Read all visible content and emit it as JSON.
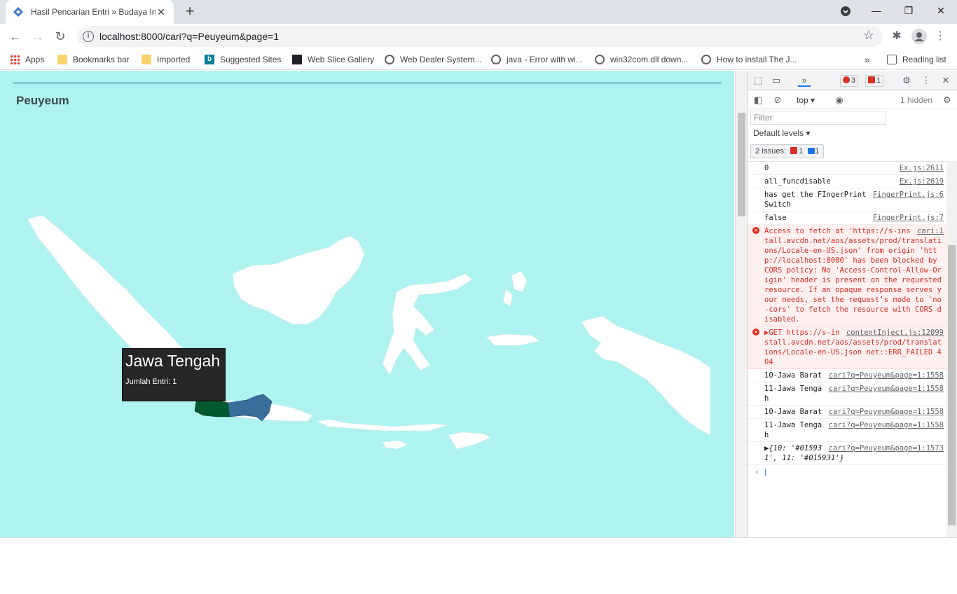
{
  "browser": {
    "tab_title": "Hasil Pencarian Entri » Budaya In",
    "url": "localhost:8000/cari?q=Peuyeum&page=1",
    "bookmarks": [
      {
        "label": "Apps",
        "icon": "apps-grid-icon"
      },
      {
        "label": "Bookmarks bar",
        "icon": "folder-icon"
      },
      {
        "label": "Imported",
        "icon": "folder-icon"
      },
      {
        "label": "Suggested Sites",
        "icon": "bing-icon"
      },
      {
        "label": "Web Slice Gallery",
        "icon": "web-slice-icon"
      },
      {
        "label": "Web Dealer System...",
        "icon": "globe-icon"
      },
      {
        "label": "java - Error with wi...",
        "icon": "globe-icon"
      },
      {
        "label": "win32com.dll down...",
        "icon": "globe-icon"
      },
      {
        "label": "How to install The J...",
        "icon": "globe-icon"
      }
    ],
    "reading_list": "Reading list"
  },
  "page": {
    "heading": "Peuyeum",
    "tooltip": {
      "title": "Jawa Tengah",
      "subtitle": "Jumlah Entri: 1"
    },
    "colors": {
      "background": "#aff3f0",
      "jawa_barat": "#015931",
      "jawa_tengah": "#3a6e9a"
    }
  },
  "devtools": {
    "errors_count": "3",
    "issues_badge_count": "1",
    "context": "top",
    "hidden": "1 hidden",
    "filter_placeholder": "Filter",
    "levels": "Default levels",
    "issues_label": "2 Issues:",
    "issues_err": "1",
    "issues_info": "1",
    "messages": [
      {
        "text": "0",
        "src": "Ex.js:2611",
        "type": "log"
      },
      {
        "text": "all_funcdisable",
        "src": "Ex.js:2619",
        "type": "log"
      },
      {
        "text": "has get the FIngerPrintSwitch",
        "src": "FingerPrint.js:6",
        "type": "log"
      },
      {
        "text": "false",
        "src": "FingerPrint.js:7",
        "type": "log"
      },
      {
        "text": "Access to fetch at 'https://s-install.avcdn.net/aos/assets/prod/translations/Locale-en-US.json' from origin 'http://localhost:8000' has been blocked by CORS policy: No 'Access-Control-Allow-Origin' header is present on the requested resource. If an opaque response serves your needs, set the request's mode to 'no-cors' to fetch the resource with CORS disabled.",
        "src": "cari:1",
        "type": "error"
      },
      {
        "text": "▶GET https://s-install.avcdn.net/aos/assets/prod/translations/Locale-en-US.json net::ERR_FAILED 404",
        "src": "contentInject.js:12099",
        "type": "error"
      },
      {
        "text": "10-Jawa Barat",
        "src": "cari?q=Peuyeum&page=1:1558",
        "type": "log"
      },
      {
        "text": "11-Jawa Tengah",
        "src": "cari?q=Peuyeum&page=1:1558",
        "type": "log"
      },
      {
        "text": "10-Jawa Barat",
        "src": "cari?q=Peuyeum&page=1:1558",
        "type": "log"
      },
      {
        "text": "11-Jawa Tengah",
        "src": "cari?q=Peuyeum&page=1:1558",
        "type": "log"
      },
      {
        "text": "▶{10: '#015931', 11: '#015931'}",
        "src": "cari?q=Peuyeum&page=1:1573",
        "type": "log"
      }
    ]
  }
}
